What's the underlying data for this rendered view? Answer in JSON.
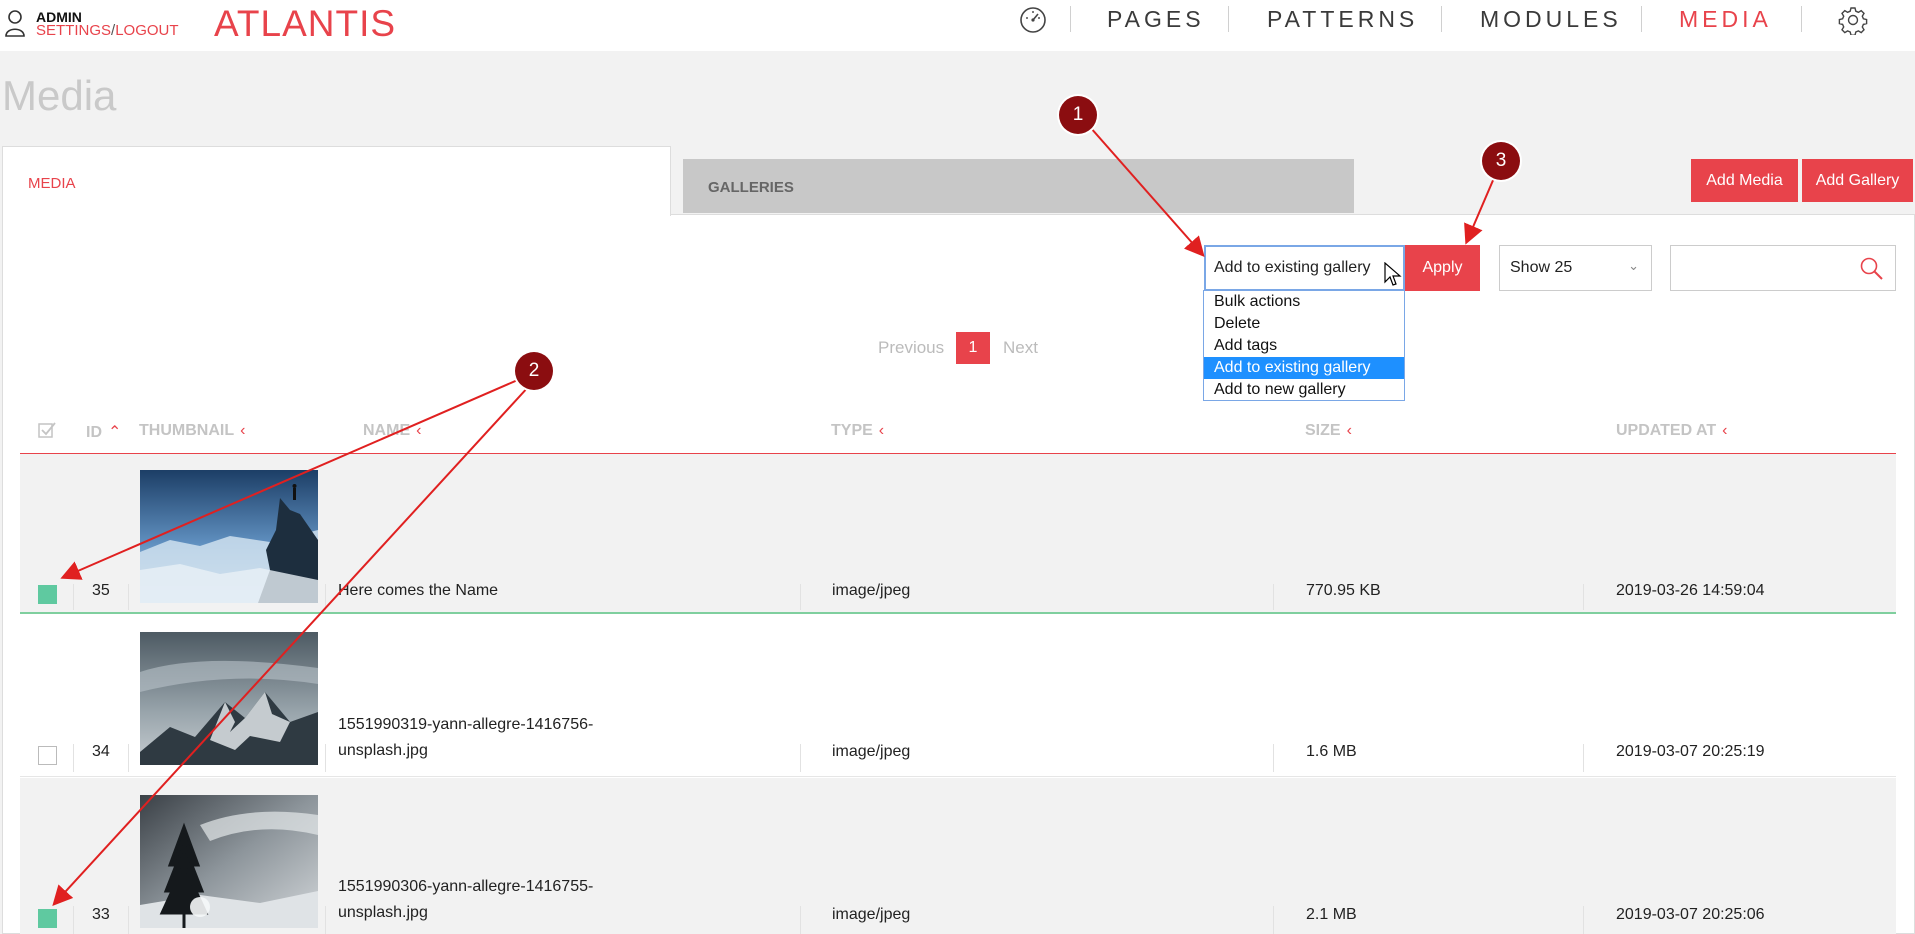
{
  "header": {
    "user_name": "ADMIN",
    "settings_link": "SETTINGS",
    "separator": "/",
    "logout_link": "LOGOUT",
    "brand": "ATLANTIS",
    "nav": [
      "PAGES",
      "PATTERNS",
      "MODULES",
      "MEDIA"
    ],
    "active_nav": "MEDIA"
  },
  "page_title": "Media",
  "tabs": {
    "media": "MEDIA",
    "galleries": "GALLERIES"
  },
  "actions": {
    "add_media": "Add Media",
    "add_gallery": "Add Gallery"
  },
  "bulk": {
    "selected": "Add to existing gallery",
    "options": [
      "Bulk actions",
      "Delete",
      "Add tags",
      "Add to existing gallery",
      "Add to new gallery"
    ],
    "apply_label": "Apply"
  },
  "show": {
    "selected": "Show 25"
  },
  "search": {
    "value": ""
  },
  "pagination": {
    "previous": "Previous",
    "current": "1",
    "next": "Next"
  },
  "table": {
    "columns": [
      "ID",
      "THUMBNAIL",
      "NAME",
      "TYPE",
      "SIZE",
      "UPDATED AT"
    ],
    "rows": [
      {
        "checked": true,
        "id": "35",
        "name_line1": "Here comes the Name",
        "name_line2": "",
        "type": "image/jpeg",
        "size": "770.95 KB",
        "updated": "2019-03-26 14:59:04"
      },
      {
        "checked": false,
        "id": "34",
        "name_line1": "1551990319-yann-allegre-1416756-",
        "name_line2": "unsplash.jpg",
        "type": "image/jpeg",
        "size": "1.6 MB",
        "updated": "2019-03-07 20:25:19"
      },
      {
        "checked": true,
        "id": "33",
        "name_line1": "1551990306-yann-allegre-1416755-",
        "name_line2": "unsplash.jpg",
        "type": "image/jpeg",
        "size": "2.1 MB",
        "updated": "2019-03-07 20:25:06"
      }
    ]
  },
  "annotations": {
    "m1": "1",
    "m2": "2",
    "m3": "3"
  },
  "colors": {
    "accent": "#e8434b",
    "marker": "#8b0d10",
    "checked": "#5fc9a0"
  }
}
